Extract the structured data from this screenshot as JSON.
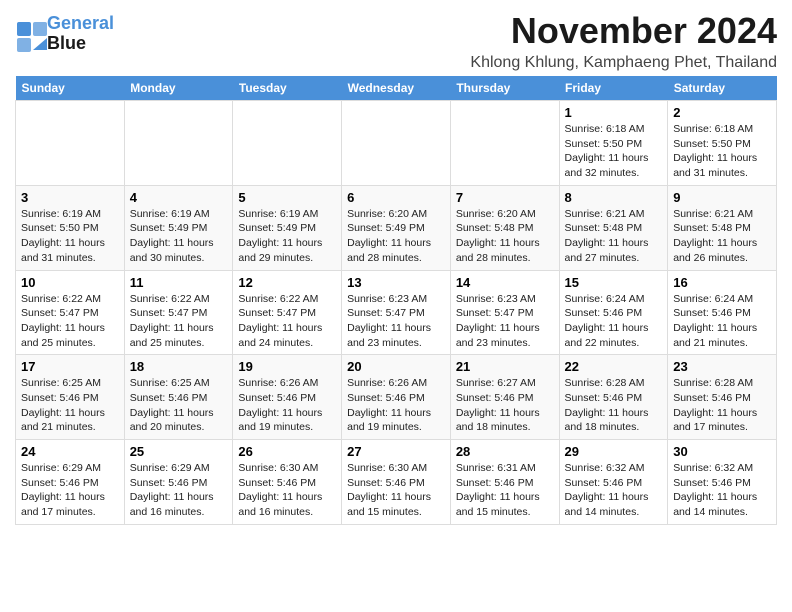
{
  "logo": {
    "line1": "General",
    "line2": "Blue"
  },
  "title": "November 2024",
  "subtitle": "Khlong Khlung, Kamphaeng Phet, Thailand",
  "weekdays": [
    "Sunday",
    "Monday",
    "Tuesday",
    "Wednesday",
    "Thursday",
    "Friday",
    "Saturday"
  ],
  "weeks": [
    [
      {
        "day": "",
        "info": ""
      },
      {
        "day": "",
        "info": ""
      },
      {
        "day": "",
        "info": ""
      },
      {
        "day": "",
        "info": ""
      },
      {
        "day": "",
        "info": ""
      },
      {
        "day": "1",
        "info": "Sunrise: 6:18 AM\nSunset: 5:50 PM\nDaylight: 11 hours and 32 minutes."
      },
      {
        "day": "2",
        "info": "Sunrise: 6:18 AM\nSunset: 5:50 PM\nDaylight: 11 hours and 31 minutes."
      }
    ],
    [
      {
        "day": "3",
        "info": "Sunrise: 6:19 AM\nSunset: 5:50 PM\nDaylight: 11 hours and 31 minutes."
      },
      {
        "day": "4",
        "info": "Sunrise: 6:19 AM\nSunset: 5:49 PM\nDaylight: 11 hours and 30 minutes."
      },
      {
        "day": "5",
        "info": "Sunrise: 6:19 AM\nSunset: 5:49 PM\nDaylight: 11 hours and 29 minutes."
      },
      {
        "day": "6",
        "info": "Sunrise: 6:20 AM\nSunset: 5:49 PM\nDaylight: 11 hours and 28 minutes."
      },
      {
        "day": "7",
        "info": "Sunrise: 6:20 AM\nSunset: 5:48 PM\nDaylight: 11 hours and 28 minutes."
      },
      {
        "day": "8",
        "info": "Sunrise: 6:21 AM\nSunset: 5:48 PM\nDaylight: 11 hours and 27 minutes."
      },
      {
        "day": "9",
        "info": "Sunrise: 6:21 AM\nSunset: 5:48 PM\nDaylight: 11 hours and 26 minutes."
      }
    ],
    [
      {
        "day": "10",
        "info": "Sunrise: 6:22 AM\nSunset: 5:47 PM\nDaylight: 11 hours and 25 minutes."
      },
      {
        "day": "11",
        "info": "Sunrise: 6:22 AM\nSunset: 5:47 PM\nDaylight: 11 hours and 25 minutes."
      },
      {
        "day": "12",
        "info": "Sunrise: 6:22 AM\nSunset: 5:47 PM\nDaylight: 11 hours and 24 minutes."
      },
      {
        "day": "13",
        "info": "Sunrise: 6:23 AM\nSunset: 5:47 PM\nDaylight: 11 hours and 23 minutes."
      },
      {
        "day": "14",
        "info": "Sunrise: 6:23 AM\nSunset: 5:47 PM\nDaylight: 11 hours and 23 minutes."
      },
      {
        "day": "15",
        "info": "Sunrise: 6:24 AM\nSunset: 5:46 PM\nDaylight: 11 hours and 22 minutes."
      },
      {
        "day": "16",
        "info": "Sunrise: 6:24 AM\nSunset: 5:46 PM\nDaylight: 11 hours and 21 minutes."
      }
    ],
    [
      {
        "day": "17",
        "info": "Sunrise: 6:25 AM\nSunset: 5:46 PM\nDaylight: 11 hours and 21 minutes."
      },
      {
        "day": "18",
        "info": "Sunrise: 6:25 AM\nSunset: 5:46 PM\nDaylight: 11 hours and 20 minutes."
      },
      {
        "day": "19",
        "info": "Sunrise: 6:26 AM\nSunset: 5:46 PM\nDaylight: 11 hours and 19 minutes."
      },
      {
        "day": "20",
        "info": "Sunrise: 6:26 AM\nSunset: 5:46 PM\nDaylight: 11 hours and 19 minutes."
      },
      {
        "day": "21",
        "info": "Sunrise: 6:27 AM\nSunset: 5:46 PM\nDaylight: 11 hours and 18 minutes."
      },
      {
        "day": "22",
        "info": "Sunrise: 6:28 AM\nSunset: 5:46 PM\nDaylight: 11 hours and 18 minutes."
      },
      {
        "day": "23",
        "info": "Sunrise: 6:28 AM\nSunset: 5:46 PM\nDaylight: 11 hours and 17 minutes."
      }
    ],
    [
      {
        "day": "24",
        "info": "Sunrise: 6:29 AM\nSunset: 5:46 PM\nDaylight: 11 hours and 17 minutes."
      },
      {
        "day": "25",
        "info": "Sunrise: 6:29 AM\nSunset: 5:46 PM\nDaylight: 11 hours and 16 minutes."
      },
      {
        "day": "26",
        "info": "Sunrise: 6:30 AM\nSunset: 5:46 PM\nDaylight: 11 hours and 16 minutes."
      },
      {
        "day": "27",
        "info": "Sunrise: 6:30 AM\nSunset: 5:46 PM\nDaylight: 11 hours and 15 minutes."
      },
      {
        "day": "28",
        "info": "Sunrise: 6:31 AM\nSunset: 5:46 PM\nDaylight: 11 hours and 15 minutes."
      },
      {
        "day": "29",
        "info": "Sunrise: 6:32 AM\nSunset: 5:46 PM\nDaylight: 11 hours and 14 minutes."
      },
      {
        "day": "30",
        "info": "Sunrise: 6:32 AM\nSunset: 5:46 PM\nDaylight: 11 hours and 14 minutes."
      }
    ]
  ]
}
